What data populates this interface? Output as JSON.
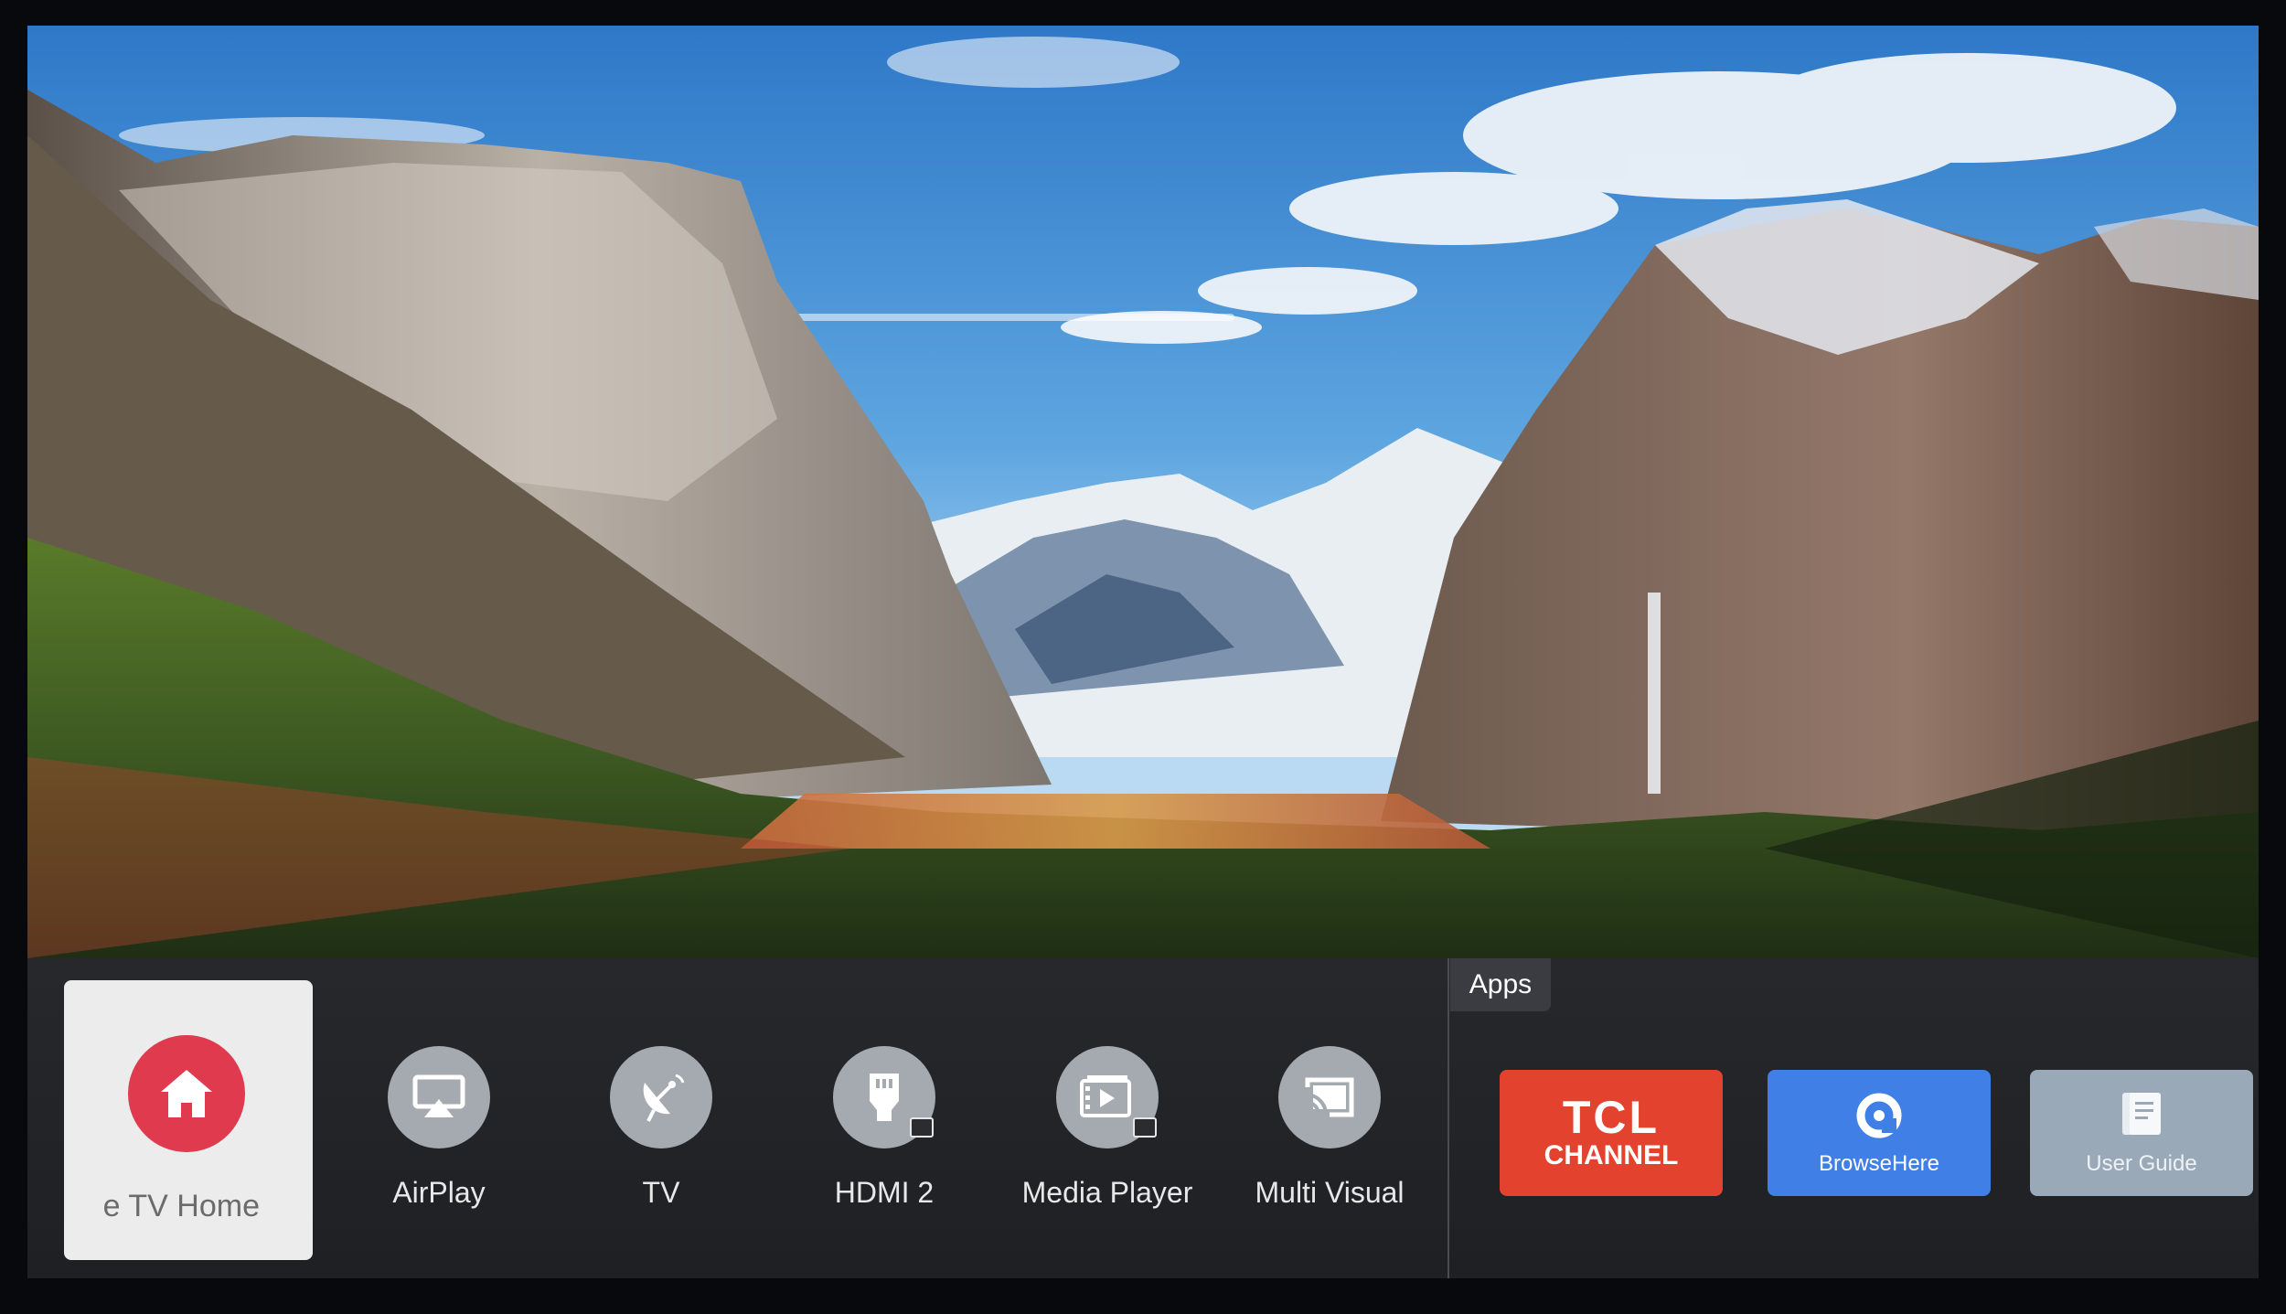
{
  "dock": {
    "home": {
      "label": "e TV Home",
      "accent": "#e03a4e"
    },
    "inputs": [
      {
        "label": "AirPlay",
        "icon": "airplay-icon"
      },
      {
        "label": "TV",
        "icon": "satellite-dish-icon"
      },
      {
        "label": "HDMI 2",
        "icon": "hdmi-icon"
      },
      {
        "label": "Media Player",
        "icon": "media-player-icon"
      },
      {
        "label": "Multi Visual",
        "icon": "cast-icon"
      }
    ]
  },
  "apps": {
    "section_label": "Apps",
    "tiles": [
      {
        "name": "TCL CHANNEL",
        "logo_top": "TCL",
        "logo_bottom": "CHANNEL",
        "color": "#e3422f"
      },
      {
        "name": "BrowseHere",
        "color": "#3f7fe6"
      },
      {
        "name": "User Guide",
        "color": "#9aa9b8"
      }
    ]
  }
}
